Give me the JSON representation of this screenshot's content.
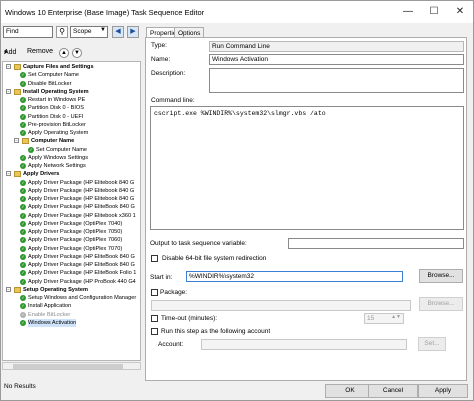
{
  "window": {
    "title": "Windows 10 Enterprise (Base Image) Task Sequence Editor",
    "minimize_icon": "minimize-icon",
    "maximize_icon": "maximize-icon",
    "close_icon": "close-icon"
  },
  "toolbar": {
    "find_value": "Find",
    "scope_value": "Scope",
    "add_label": "Add",
    "remove_label": "Remove"
  },
  "tree": {
    "items": [
      {
        "label": "Capture Files and Settings",
        "type": "group",
        "level": 0
      },
      {
        "label": "Set Computer Name",
        "type": "step",
        "level": 1
      },
      {
        "label": "Disable BitLocker",
        "type": "step",
        "level": 1
      },
      {
        "label": "Install Operating System",
        "type": "group",
        "level": 0
      },
      {
        "label": "Restart in Windows PE",
        "type": "step",
        "level": 1
      },
      {
        "label": "Partition Disk 0 - BIOS",
        "type": "step",
        "level": 1
      },
      {
        "label": "Partition Disk 0 - UEFI",
        "type": "step",
        "level": 1
      },
      {
        "label": "Pre-provision BitLocker",
        "type": "step",
        "level": 1
      },
      {
        "label": "Apply Operating System",
        "type": "step",
        "level": 1
      },
      {
        "label": "Computer Name",
        "type": "group",
        "level": 1
      },
      {
        "label": "Set Computer Name",
        "type": "step",
        "level": 2
      },
      {
        "label": "Apply Windows Settings",
        "type": "step",
        "level": 1
      },
      {
        "label": "Apply Network Settings",
        "type": "step",
        "level": 1
      },
      {
        "label": "Apply Drivers",
        "type": "group",
        "level": 0
      },
      {
        "label": "Apply Driver Package (HP Elitebook 840 G",
        "type": "step",
        "level": 1
      },
      {
        "label": "Apply Driver Package (HP Elitebook 840 G",
        "type": "step",
        "level": 1
      },
      {
        "label": "Apply Driver Package (HP Elitebook 840 G",
        "type": "step",
        "level": 1
      },
      {
        "label": "Apply Driver Package (HP EliteBook 840 G",
        "type": "step",
        "level": 1
      },
      {
        "label": "Apply Driver Package (HP Elitebook x360 1",
        "type": "step",
        "level": 1
      },
      {
        "label": "Apply Driver Package (OptiPlex 7040)",
        "type": "step",
        "level": 1
      },
      {
        "label": "Apply Driver Package (OptiPlex 7050)",
        "type": "step",
        "level": 1
      },
      {
        "label": "Apply Driver Package (OptiPlex 7060)",
        "type": "step",
        "level": 1
      },
      {
        "label": "Apply Driver Package (OptiPlex 7070)",
        "type": "step",
        "level": 1
      },
      {
        "label": "Apply Driver Package (HP EliteBook 840 G",
        "type": "step",
        "level": 1
      },
      {
        "label": "Apply Driver Package (HP EliteBook 840 G",
        "type": "step",
        "level": 1
      },
      {
        "label": "Apply Driver Package (HP EliteBook Folio 1",
        "type": "step",
        "level": 1
      },
      {
        "label": "Apply Driver Package (HP ProBook 440 G4",
        "type": "step",
        "level": 1
      },
      {
        "label": "Setup Operating System",
        "type": "group",
        "level": 0
      },
      {
        "label": "Setup Windows and Configuration Manager",
        "type": "step",
        "level": 1
      },
      {
        "label": "Install Application",
        "type": "step",
        "level": 1
      },
      {
        "label": "Enable BitLocker",
        "type": "step",
        "level": 1,
        "disabled": true
      },
      {
        "label": "Windows Activation",
        "type": "step",
        "level": 1,
        "selected": true
      }
    ]
  },
  "tabs": {
    "properties": "Properties",
    "options": "Options"
  },
  "properties": {
    "type_label": "Type:",
    "type_value": "Run Command Line",
    "name_label": "Name:",
    "name_value": "Windows Activation",
    "description_label": "Description:",
    "description_value": "",
    "command_line_label": "Command line:",
    "command_line_value": "cscript.exe %WINDIR%\\system32\\slmgr.vbs /ato",
    "output_label": "Output to task sequence variable:",
    "output_value": "",
    "disable64_label": "Disable 64-bit file system redirection",
    "start_in_label": "Start in:",
    "start_in_value": "%WINDIR%\\system32",
    "browse_label": "Browse...",
    "package_label": "Package:",
    "package_value": "",
    "package_browse_label": "Browse...",
    "timeout_label": "Time-out (minutes):",
    "timeout_value": "15",
    "run_as_label": "Run this step as the following account",
    "account_label": "Account:",
    "account_value": "",
    "set_label": "Set..."
  },
  "footer": {
    "status": "No Results",
    "ok": "OK",
    "cancel": "Cancel",
    "apply": "Apply"
  }
}
